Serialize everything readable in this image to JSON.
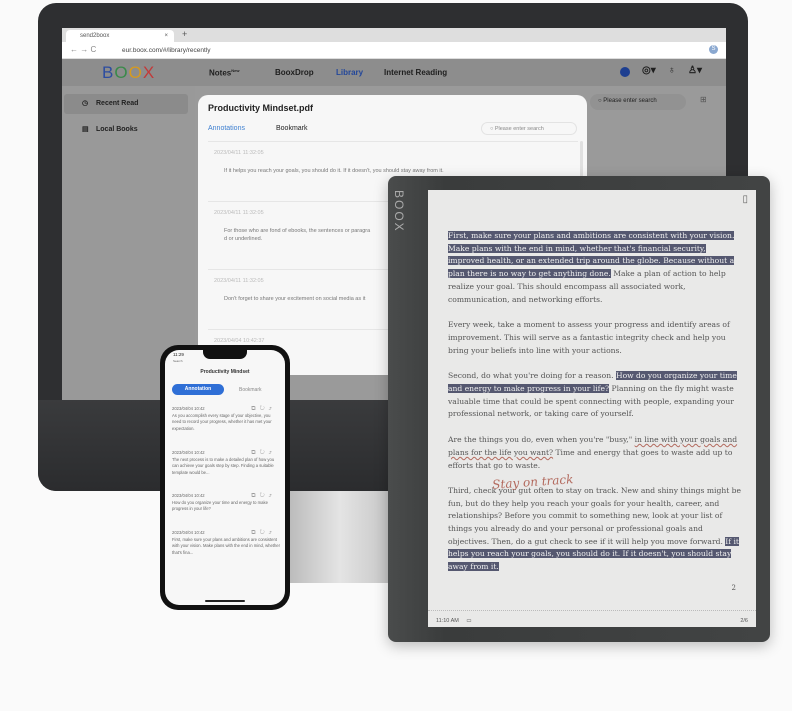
{
  "browser": {
    "tab_title": "send2boox",
    "url": "eur.boox.com/#/library/recently",
    "avatar_letter": "S"
  },
  "app": {
    "logo": "BOOX",
    "nav": [
      {
        "label": "Notes",
        "badge": "New"
      },
      {
        "label": "BooxDrop"
      },
      {
        "label": "Library",
        "active": true
      },
      {
        "label": "Internet Reading"
      }
    ],
    "search_placeholder": "Please enter search",
    "sidebar": [
      {
        "label": "Recent Read",
        "icon": "clock-icon",
        "active": true
      },
      {
        "label": "Local Books",
        "icon": "book-icon"
      }
    ]
  },
  "modal": {
    "title": "Productivity Mindset.pdf",
    "tabs": [
      "Annotations",
      "Bookmark"
    ],
    "search_placeholder": "Please enter search",
    "notes": [
      {
        "time": "2023/04/11 11:32:05",
        "text": "If it helps you reach your goals, you should do it. If it doesn't, you should stay away from it."
      },
      {
        "time": "2023/04/11 11:32:05",
        "text": "For those who are fond of ebooks, the sentences or paragra",
        "text2": "d or underlined."
      },
      {
        "time": "2023/04/11 11:32:05",
        "text": "Don't forget to share your excitement on social media as it"
      },
      {
        "time": "2023/04/04 10:42:37",
        "text": ""
      }
    ]
  },
  "reader": {
    "brand": "BOOX",
    "page_number": "2",
    "time": "11:10 AM",
    "page_indicator": "2/6",
    "handwriting": "Stay on track",
    "p1": {
      "hl": "First, make sure your plans and ambitions are consistent with your vision. Make plans with the end in mind, whether that's financial security, improved health, or an extended trip around the globe. Because without a plan there is no way to get anything done.",
      "rest": " Make a plan of action to help realize your goal. This should encompass all associated work, communication, and networking efforts."
    },
    "p2": "Every week, take a moment to assess your progress and identify areas of improvement. This will serve as a fantastic integrity check and help you bring your beliefs into line with your actions.",
    "p3": {
      "pre": "Second, do what you're doing for a reason. ",
      "hl": "How do you organize your time and energy to make progress in your life?",
      "rest": " Planning on the fly might waste valuable time that could be spent connecting with people, expanding your professional network, or taking care of yourself."
    },
    "p4": {
      "pre": "Are the things you do, even when you're \"busy,\" ",
      "ul": "in line with your goals and plans for the life you want?",
      "rest": " Time and energy that goes to waste add up to efforts that go to waste."
    },
    "p5": {
      "pre": "Third, check your gut often to stay on track. New and shiny things might be fun, but do they help you reach your goals for your health, career, and relationships? Before you commit to something new, look at your list of things you already do and your personal or professional goals and objectives. Then, do a gut check to see if it will help you move forward. ",
      "hl": "If it helps you reach your goals, you should do it. If it doesn't, you should stay away from it."
    }
  },
  "phone": {
    "time": "11:29",
    "back": "Search",
    "title": "Productivity Mindset",
    "tabs": [
      "Annotation",
      "Bookmark"
    ],
    "notes": [
      {
        "time": "2023/04/04 10:42",
        "text": "As you accomplish every stage of your objective, you need to record your progress, whether it has met your expectation."
      },
      {
        "time": "2023/04/04 10:42",
        "text": "The next process is to make a detailed plan of how you can achieve your goals step by step. Finding a suitable template would be..."
      },
      {
        "time": "2023/04/04 10:42",
        "text": "How do you organize your time and energy to make progress in your life?"
      },
      {
        "time": "2023/04/04 10:42",
        "text": "First, make sure your plans and ambitions are consistent with your vision. Make plans with the end in mind, whether that's fina..."
      }
    ]
  },
  "colors": {
    "accent": "#2f6fd6",
    "highlight": "#555870",
    "ink": "#b36a5e",
    "bezel": "#3c3f3f"
  }
}
